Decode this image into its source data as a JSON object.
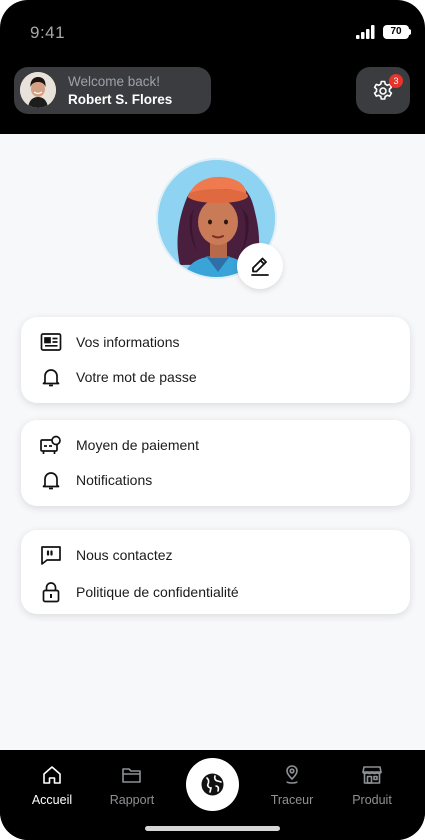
{
  "status_bar": {
    "time": "9:41",
    "battery": "70"
  },
  "header": {
    "welcome": "Welcome back!",
    "username": "Robert S. Flores",
    "settings_badge": "3"
  },
  "menu": {
    "card1": [
      {
        "label": "Vos informations",
        "icon": "id-card-icon"
      },
      {
        "label": "Votre mot de passe",
        "icon": "bell-icon"
      }
    ],
    "card2": [
      {
        "label": "Moyen de paiement",
        "icon": "payment-icon"
      },
      {
        "label": "Notifications",
        "icon": "bell-icon"
      }
    ],
    "card3": [
      {
        "label": "Nous contactez",
        "icon": "quote-chat-icon"
      },
      {
        "label": "Politique de confidentialité",
        "icon": "lock-icon"
      }
    ]
  },
  "nav": {
    "home": "Accueil",
    "report": "Rapport",
    "tracker": "Traceur",
    "product": "Produit"
  },
  "colors": {
    "header_bg": "#000000",
    "pill_bg": "#3a3c40",
    "content_bg": "#f7f8fa",
    "badge": "#e8332a",
    "avatar_bg": "#8fd3f2"
  }
}
